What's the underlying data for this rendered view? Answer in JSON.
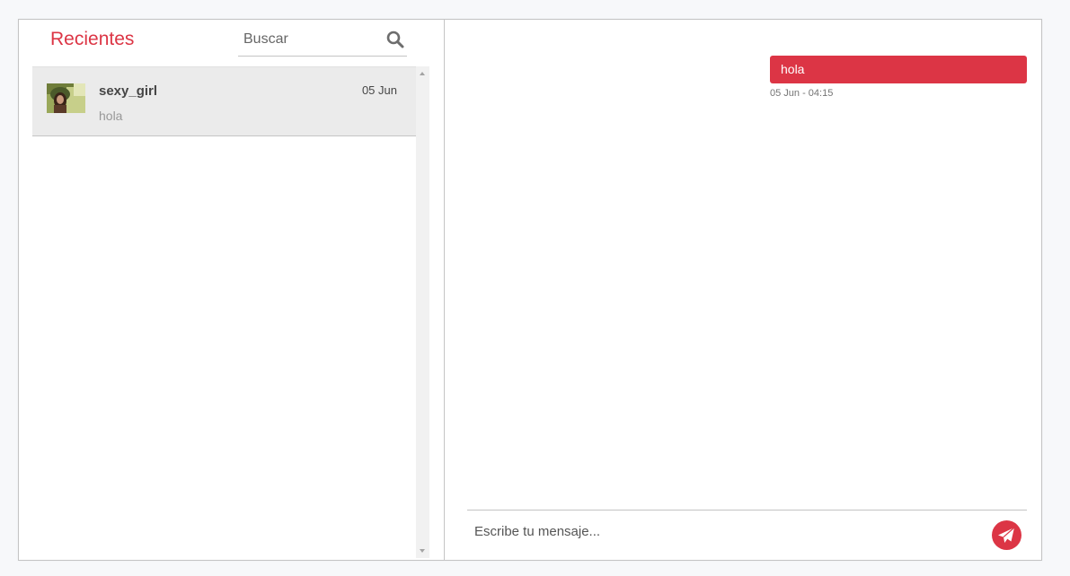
{
  "sidebar": {
    "heading": "Recientes",
    "search": {
      "placeholder": "Buscar",
      "value": ""
    },
    "chats": [
      {
        "name": "sexy_girl",
        "date": "05 Jun",
        "preview": "hola"
      }
    ]
  },
  "conversation": {
    "messages": [
      {
        "text": "hola",
        "time": "05 Jun - 04:15",
        "direction": "outgoing"
      }
    ],
    "composer": {
      "placeholder": "Escribe tu mensaje...",
      "value": ""
    }
  },
  "colors": {
    "accent": "#dc3545",
    "selected_row": "#ebebeb",
    "border": "#c4c4c4"
  },
  "icons": {
    "search": "search-icon",
    "send": "paper-plane-icon",
    "avatar": "avatar"
  }
}
